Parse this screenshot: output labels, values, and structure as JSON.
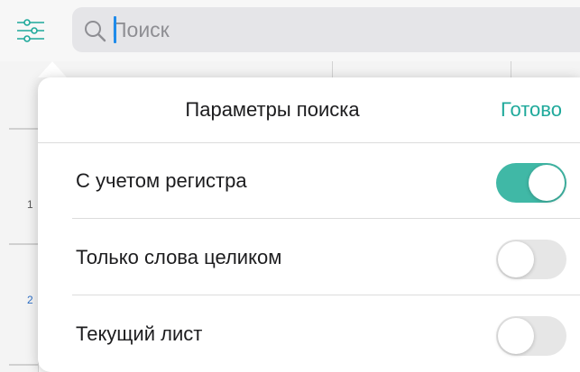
{
  "search": {
    "placeholder": "Поиск",
    "value": ""
  },
  "toolbar": {
    "filter_icon": "sliders-icon",
    "search_icon": "magnifier-icon"
  },
  "sheet": {
    "row_numbers": [
      "1",
      "2"
    ]
  },
  "popover": {
    "title": "Параметры поиска",
    "done_label": "Готово",
    "options": [
      {
        "label": "С учетом регистра",
        "enabled": true
      },
      {
        "label": "Только слова целиком",
        "enabled": false
      },
      {
        "label": "Текущий лист",
        "enabled": false
      }
    ]
  },
  "colors": {
    "accent": "#1fa99b",
    "toggle_on": "#40b8a6",
    "caret": "#1f8bea"
  }
}
